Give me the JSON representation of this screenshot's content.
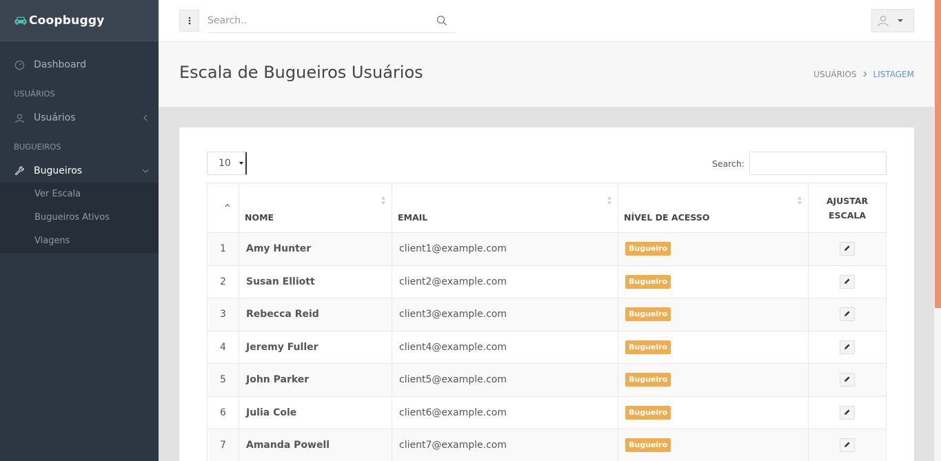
{
  "brand": {
    "name": "Coopbuggy"
  },
  "sidebar": {
    "dashboard_label": "Dashboard",
    "section_users": "USUÁRIOS",
    "users_label": "Usuários",
    "section_bugueiros": "BUGUEIROS",
    "bugueiros_label": "Bugueiros",
    "subitems": [
      "Ver Escala",
      "Bugueiros Ativos",
      "Viagens"
    ]
  },
  "topbar": {
    "search_placeholder": "Search.."
  },
  "header": {
    "title": "Escala de Bugueiros Usuários",
    "breadcrumb": [
      "USUÁRIOS",
      "LISTAGEM"
    ]
  },
  "table_controls": {
    "page_length": "10",
    "search_label": "Search:"
  },
  "table": {
    "columns": [
      "NOME",
      "EMAIL",
      "NÍVEL DE ACESSO",
      "AJUSTAR",
      "ESCALA"
    ],
    "rows": [
      {
        "idx": "1",
        "name": "Amy Hunter",
        "email": "client1@example.com",
        "level": "Bugueiro"
      },
      {
        "idx": "2",
        "name": "Susan Elliott",
        "email": "client2@example.com",
        "level": "Bugueiro"
      },
      {
        "idx": "3",
        "name": "Rebecca Reid",
        "email": "client3@example.com",
        "level": "Bugueiro"
      },
      {
        "idx": "4",
        "name": "Jeremy Fuller",
        "email": "client4@example.com",
        "level": "Bugueiro"
      },
      {
        "idx": "5",
        "name": "John Parker",
        "email": "client5@example.com",
        "level": "Bugueiro"
      },
      {
        "idx": "6",
        "name": "Julia Cole",
        "email": "client6@example.com",
        "level": "Bugueiro"
      },
      {
        "idx": "7",
        "name": "Amanda Powell",
        "email": "client7@example.com",
        "level": "Bugueiro"
      }
    ]
  },
  "colors": {
    "sidebar": "#2d3643",
    "accent": "#5b94d1",
    "badge": "#f0ad4e",
    "brand_icon": "#4fc1b0",
    "scroll_thumb": "#f0916c"
  },
  "icons": [
    "car-icon",
    "dashboard-icon",
    "user-icon",
    "wrench-icon",
    "search-icon",
    "kebab-menu-icon",
    "avatar-icon",
    "pencil-icon"
  ]
}
